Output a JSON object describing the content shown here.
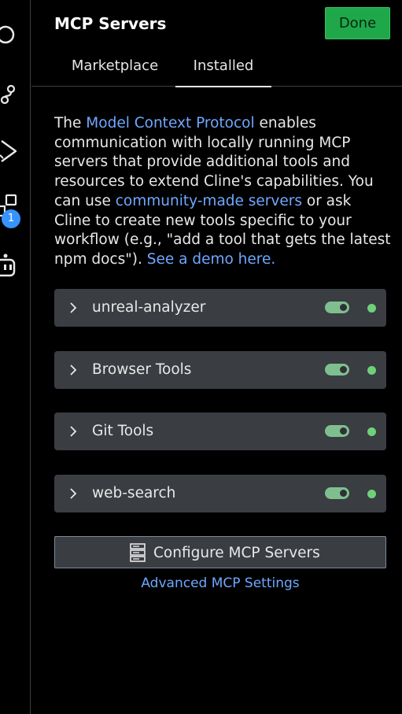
{
  "activity_bar": {
    "icons": [
      "circle-icon",
      "source-control-icon",
      "run-debug-icon",
      "extensions-icon",
      "robot-icon"
    ],
    "badge_count": "1"
  },
  "header": {
    "title": "MCP Servers",
    "done_label": "Done"
  },
  "tabs": [
    {
      "label": "Marketplace",
      "active": false
    },
    {
      "label": "Installed",
      "active": true
    }
  ],
  "description": {
    "part1": "The ",
    "link1": "Model Context Protocol",
    "part2": " enables communication with locally running MCP servers that provide additional tools and resources to extend Cline's capabilities. You can use ",
    "link2": "community-made servers",
    "part3": " or ask Cline to create new tools specific to your workflow (e.g., \"add a tool that gets the latest npm docs\"). ",
    "link3": "See a demo here."
  },
  "servers": [
    {
      "name": "unreal-analyzer",
      "enabled": true,
      "status": "connected"
    },
    {
      "name": "Browser Tools",
      "enabled": true,
      "status": "connected"
    },
    {
      "name": "Git Tools",
      "enabled": true,
      "status": "connected"
    },
    {
      "name": "web-search",
      "enabled": true,
      "status": "connected"
    }
  ],
  "configure_button": {
    "label": "Configure MCP Servers",
    "icon": "server-icon"
  },
  "advanced_link": "Advanced MCP Settings",
  "colors": {
    "accent_link": "#6fa8ff",
    "done_green": "#1fa84a",
    "status_green": "#6fd07a",
    "toggle_on": "#7fbf8f",
    "badge_blue": "#3794ff"
  }
}
